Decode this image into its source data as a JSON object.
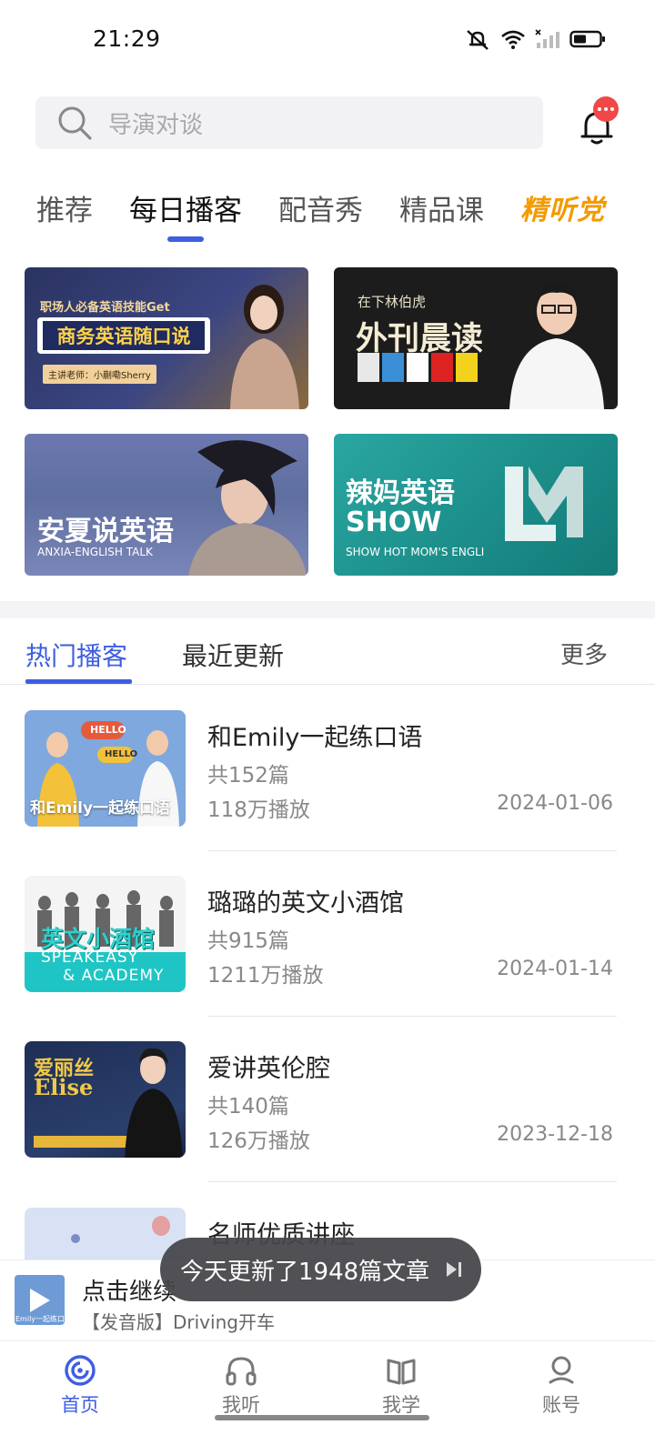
{
  "status_bar": {
    "time": "21:29"
  },
  "search": {
    "placeholder": "导演对谈"
  },
  "category_tabs": [
    {
      "label": "推荐",
      "active": false
    },
    {
      "label": "每日播客",
      "active": true
    },
    {
      "label": "配音秀",
      "active": false
    },
    {
      "label": "精品课",
      "active": false
    }
  ],
  "category_special": {
    "label": "精听党"
  },
  "banners": [
    {
      "top_text": "职场人必备英语技能Get",
      "title": "商务英语随口说",
      "teacher": "主讲老师：小蒯嘞Sherry"
    },
    {
      "subtitle": "在下林伯虎",
      "title": "外刊晨读"
    },
    {
      "title": "安夏说英语",
      "subtitle": "ANXIA-ENGLISH TALK"
    },
    {
      "title_line1": "辣妈英语",
      "title_line2": "SHOW",
      "subtitle": "SHOW HOT MOM'S ENGLI"
    }
  ],
  "sub_tabs": {
    "hot": "热门播客",
    "recent": "最近更新",
    "more": "更多"
  },
  "podcasts": [
    {
      "title": "和Emily一起练口语",
      "count": "共152篇",
      "plays": "118万播放",
      "date": "2024-01-06",
      "thumb_label": "和Emily一起练口语",
      "thumb_bubble1": "HELLO",
      "thumb_bubble2": "HELLO"
    },
    {
      "title": "璐璐的英文小酒馆",
      "count": "共915篇",
      "plays": "1211万播放",
      "date": "2024-01-14",
      "thumb_cn": "英文小酒馆",
      "thumb_en1": "SPEAKEASY",
      "thumb_en2": "& ACADEMY"
    },
    {
      "title": "爱讲英伦腔",
      "count": "共140篇",
      "plays": "126万播放",
      "date": "2023-12-18",
      "thumb_cn": "爱丽丝",
      "thumb_en": "Elise"
    },
    {
      "title": "名师优质讲座"
    }
  ],
  "toast": {
    "text": "今天更新了1948篇文章"
  },
  "player": {
    "title": "点击继续",
    "subtitle": "【发音版】Driving开车",
    "art_label": "Emily一起练口"
  },
  "bottom_nav": [
    {
      "label": "首页",
      "icon": "home-icon",
      "active": true
    },
    {
      "label": "我听",
      "icon": "headphones-icon",
      "active": false
    },
    {
      "label": "我学",
      "icon": "book-icon",
      "active": false
    },
    {
      "label": "账号",
      "icon": "account-icon",
      "active": false
    }
  ],
  "colors": {
    "accent": "#3e5ee0",
    "badge": "#f04848",
    "special_tab": "#f39a00"
  }
}
